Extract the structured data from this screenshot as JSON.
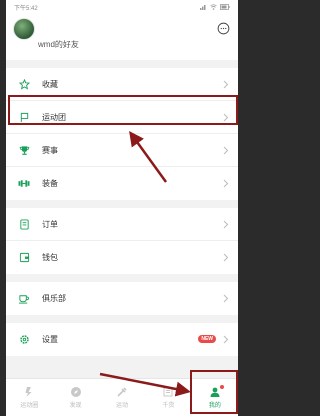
{
  "status": {
    "time": "下午5:42",
    "battery": ""
  },
  "profile": {
    "username": "wmd的好友"
  },
  "menu": {
    "group1": [
      {
        "label": "收藏",
        "icon": "star-icon"
      },
      {
        "label": "运动团",
        "icon": "flag-icon"
      },
      {
        "label": "赛事",
        "icon": "trophy-icon"
      },
      {
        "label": "装备",
        "icon": "dumbbell-icon"
      }
    ],
    "group2": [
      {
        "label": "订单",
        "icon": "order-icon"
      },
      {
        "label": "钱包",
        "icon": "wallet-icon"
      }
    ],
    "group3": [
      {
        "label": "俱乐部",
        "icon": "cup-icon"
      }
    ],
    "group4": [
      {
        "label": "设置",
        "icon": "gear-icon",
        "badge": "NEW"
      }
    ]
  },
  "tabs": [
    {
      "label": "运动圈",
      "icon": "feed-icon"
    },
    {
      "label": "发现",
      "icon": "compass-icon"
    },
    {
      "label": "运动",
      "icon": "sport-icon"
    },
    {
      "label": "千货",
      "icon": "article-icon"
    },
    {
      "label": "我的",
      "icon": "person-icon",
      "active": true
    }
  ],
  "colors": {
    "accent": "#18a058",
    "highlight": "#8b1a1a",
    "badge": "#e94b4b"
  }
}
